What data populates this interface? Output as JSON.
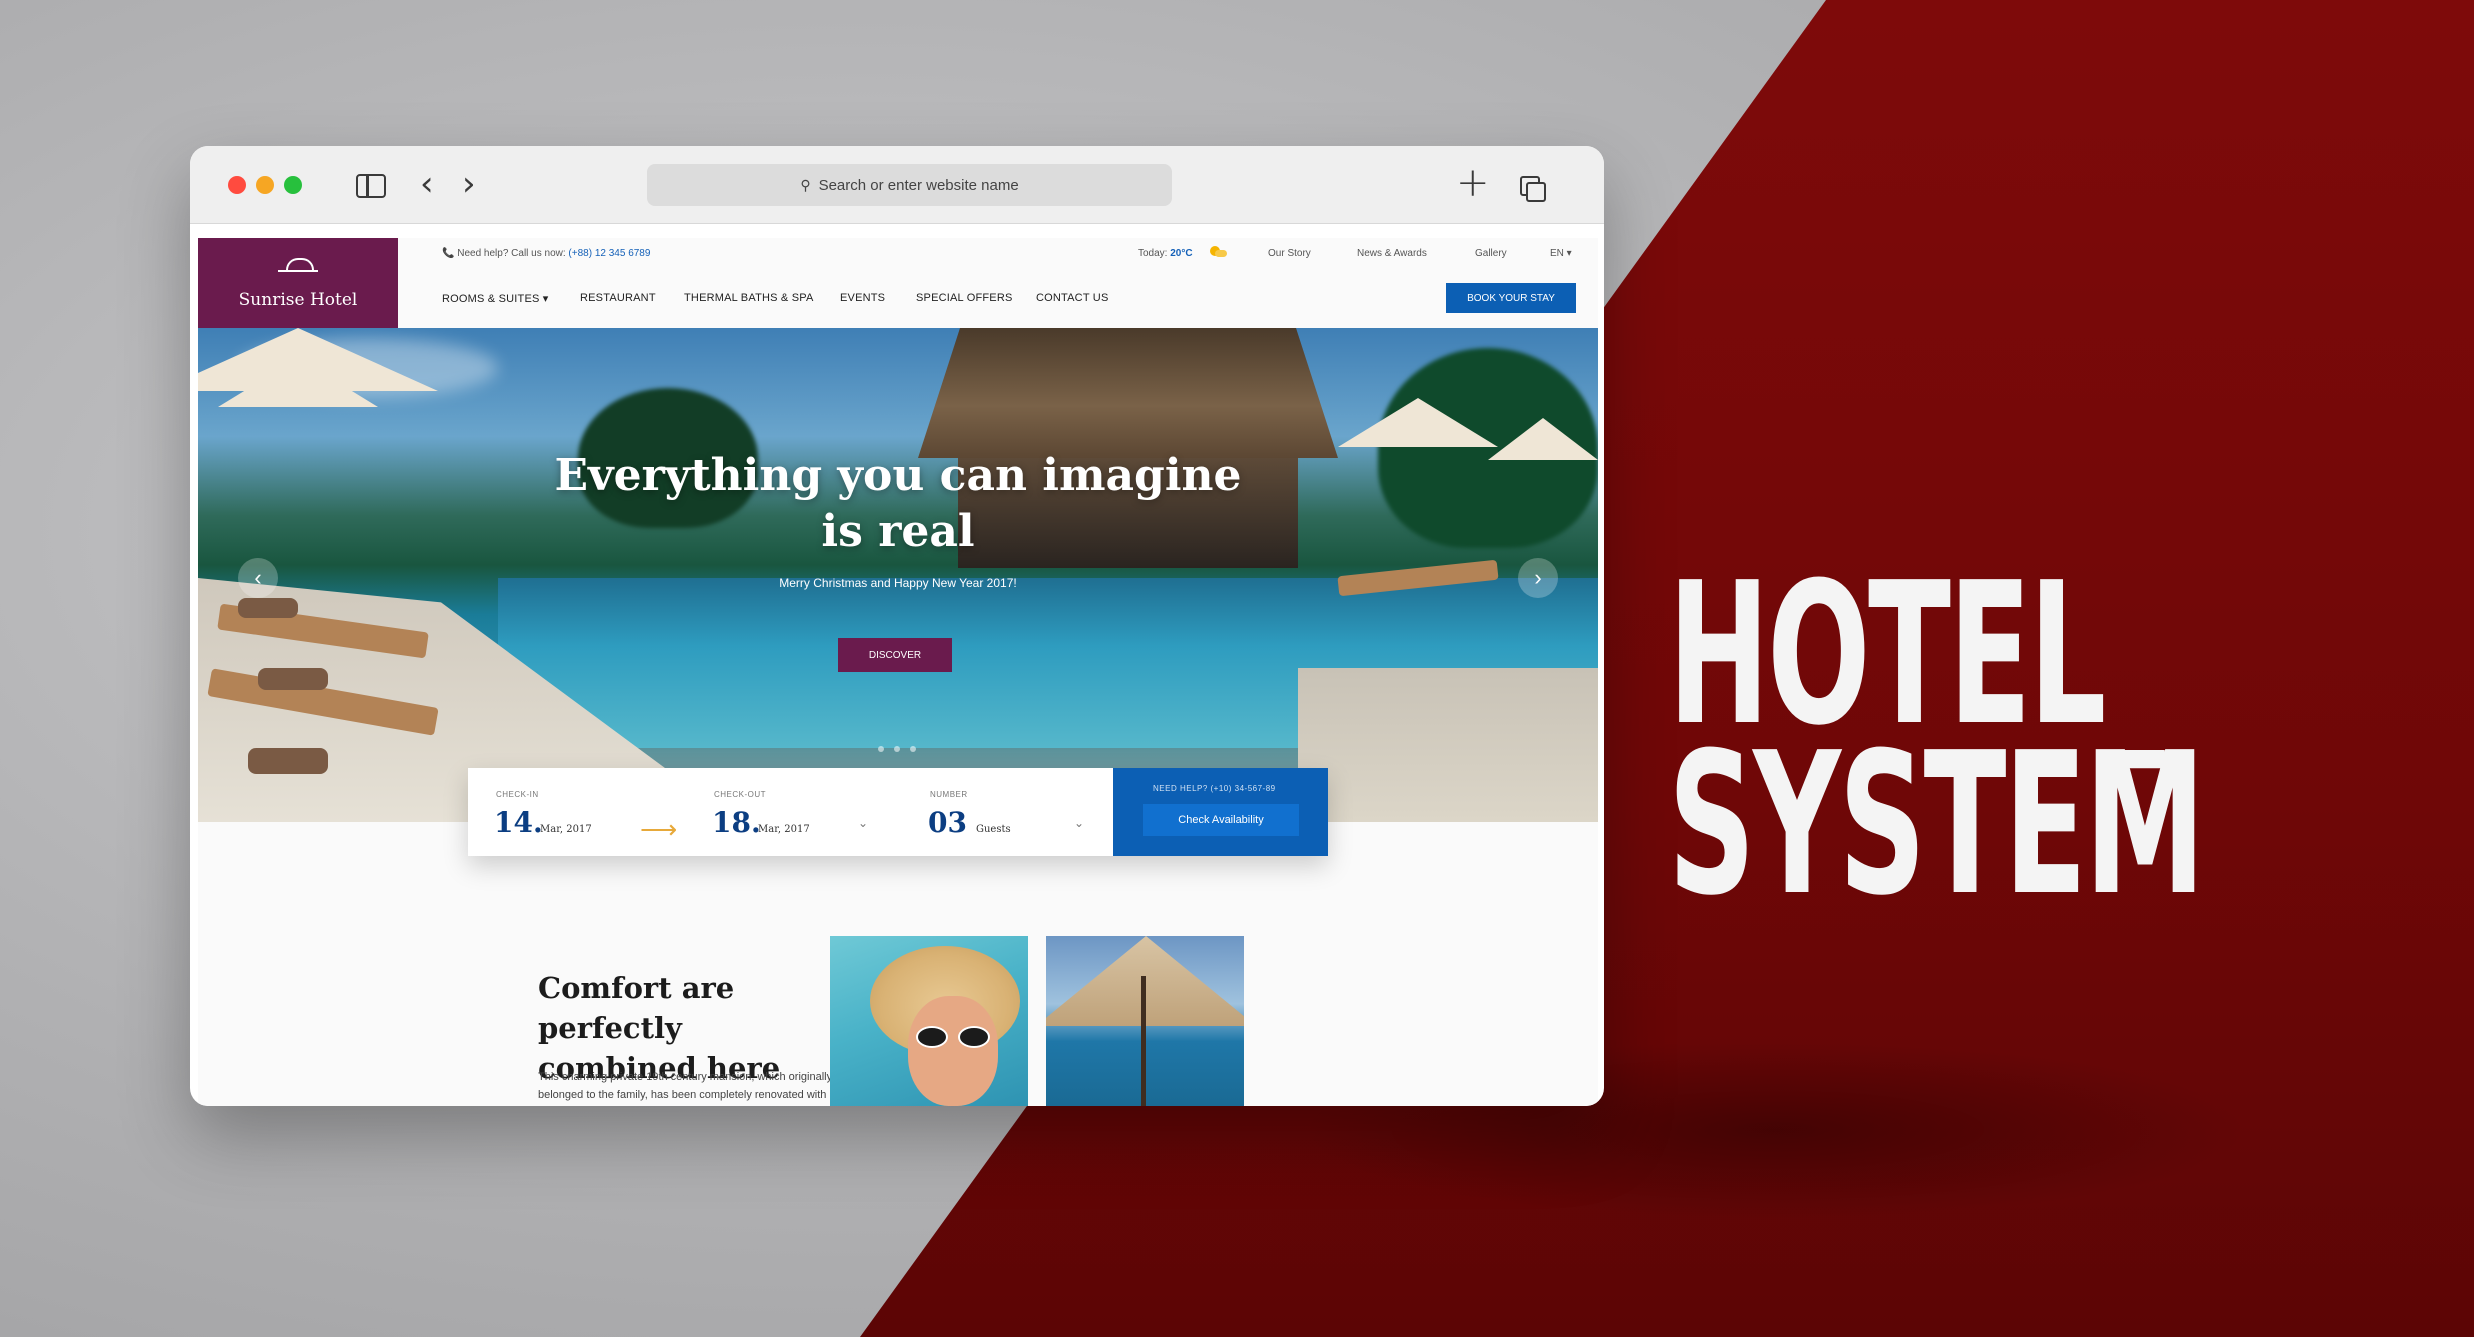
{
  "brand": {
    "line1": "HOTEL_",
    "line2": "SYSTEM"
  },
  "browser": {
    "search_placeholder": "Search or enter website name",
    "icons": [
      "sidebar-icon",
      "back-icon",
      "forward-icon",
      "search-icon",
      "new-tab-icon",
      "tabs-icon"
    ]
  },
  "site": {
    "logo_name": "Sunrise Hotel",
    "topbar": {
      "help_prefix": "📞 Need help? Call us now:",
      "help_phone": "(+88) 12 345 6789",
      "today_prefix": "Today:",
      "temperature": "20°C",
      "our_story": "Our Story",
      "news": "News & Awards",
      "gallery": "Gallery",
      "lang": "EN ▾"
    },
    "nav": {
      "rooms": "ROOMS & SUITES ▾",
      "restaurant": "RESTAURANT",
      "thermal": "THERMAL BATHS & SPA",
      "events": "EVENTS",
      "offers": "SPECIAL OFFERS",
      "contact": "CONTACT US",
      "book": "BOOK YOUR STAY"
    },
    "hero": {
      "title_line1": "Everything you can imagine",
      "title_line2": "is real",
      "subtitle": "Merry Christmas and Happy New Year 2017!",
      "cta": "DISCOVER"
    },
    "booking": {
      "checkin_label": "CHECK-IN",
      "checkin_day": "14.",
      "checkin_month": "Mar, 2017",
      "checkout_label": "CHECK-OUT",
      "checkout_day": "18.",
      "checkout_month": "Mar, 2017",
      "number_label": "NUMBER",
      "guests_num": "03",
      "guests_unit": "Guests",
      "help_text": "NEED HELP? (+10) 34-567-89",
      "check_button": "Check Availability"
    },
    "comfort": {
      "title_line1": "Comfort are perfectly",
      "title_line2": "combined here",
      "text": "This charming private 19th century mansion, which originally belonged to the family, has been completely renovated with"
    }
  }
}
